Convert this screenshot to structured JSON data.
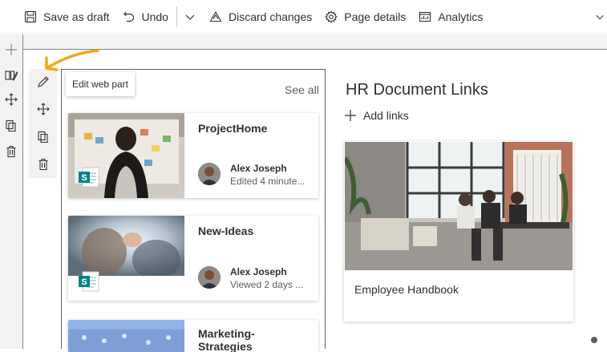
{
  "toolbar": {
    "save_draft": "Save as draft",
    "undo": "Undo",
    "discard": "Discard changes",
    "page_details": "Page details",
    "analytics": "Analytics"
  },
  "tooltip": {
    "edit_web_part": "Edit web part"
  },
  "documents": {
    "see_all": "See all",
    "items": [
      {
        "title": "ProjectHome",
        "author": "Alex Joseph",
        "activity": "Edited 4 minute..."
      },
      {
        "title": "New-Ideas",
        "author": "Alex Joseph",
        "activity": "Viewed 2 days ..."
      },
      {
        "title_line1": "Marketing-",
        "title_line2": "Strategies"
      }
    ]
  },
  "quick_links": {
    "title": "HR Document Links",
    "add_links": "Add links",
    "items": [
      {
        "label": "Employee Handbook"
      }
    ]
  },
  "icons": {
    "save": "save-icon",
    "undo": "undo-icon",
    "chevron": "chevron-down-icon",
    "discard": "discard-icon",
    "details": "gear-icon",
    "analytics": "analytics-icon",
    "sharepoint_badge": "sharepoint-file-icon"
  },
  "colors": {
    "accent_arrow": "#f2a81d",
    "sharepoint": "#038387"
  }
}
